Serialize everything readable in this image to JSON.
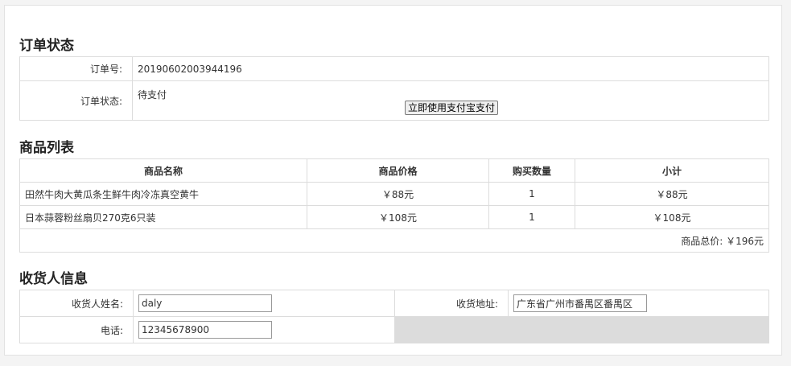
{
  "order_status": {
    "title": "订单状态",
    "order_no_label": "订单号:",
    "order_no": "20190602003944196",
    "status_label": "订单状态:",
    "status": "待支付",
    "pay_button": "立即使用支付宝支付"
  },
  "product_list": {
    "title": "商品列表",
    "headers": [
      "商品名称",
      "商品价格",
      "购买数量",
      "小计"
    ],
    "rows": [
      {
        "name": "田然牛肉大黄瓜条生鲜牛肉冷冻真空黄牛",
        "price": "￥88元",
        "qty": "1",
        "subtotal": "￥88元"
      },
      {
        "name": "日本蒜蓉粉丝扇贝270克6只装",
        "price": "￥108元",
        "qty": "1",
        "subtotal": "￥108元"
      }
    ],
    "total": "商品总价: ￥196元"
  },
  "receiver": {
    "title": "收货人信息",
    "name_label": "收货人姓名:",
    "name_value": "daly",
    "address_label": "收货地址:",
    "address_value": "广东省广州市番禺区番禺区",
    "phone_label": "电话:",
    "phone_value": "12345678900"
  }
}
